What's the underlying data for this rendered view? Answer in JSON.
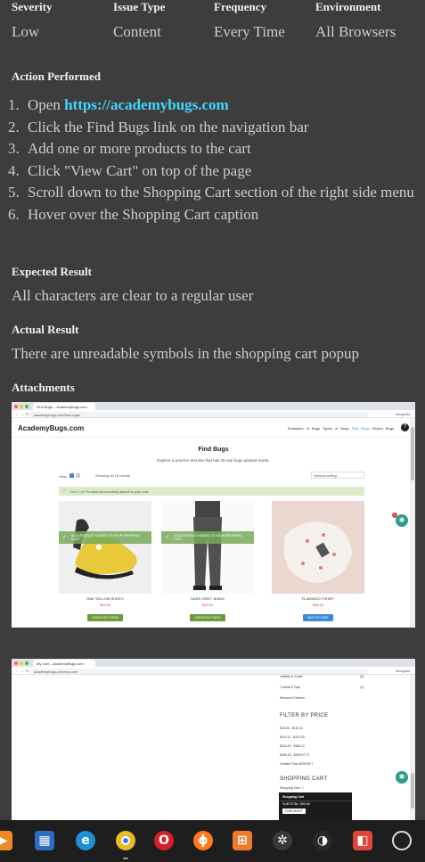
{
  "meta": {
    "headers": [
      "Severity",
      "Issue Type",
      "Frequency",
      "Environment"
    ],
    "values": [
      "Low",
      "Content",
      "Every Time",
      "All Browsers"
    ]
  },
  "action": {
    "title": "Action Performed",
    "steps": [
      {
        "num": "1.",
        "text": "Open ",
        "link": "https://academybugs.com"
      },
      {
        "num": "2.",
        "text": "Click the Find Bugs link on the navigation bar"
      },
      {
        "num": "3.",
        "text": "Add one or more products to the cart"
      },
      {
        "num": "4.",
        "text": "Click \"View Cart\" on top of the page"
      },
      {
        "num": "5.",
        "text": "Scroll down to the Shopping Cart section of the right side menu"
      },
      {
        "num": "6.",
        "text": "Hover over the Shopping Cart caption"
      }
    ]
  },
  "expected": {
    "title": "Expected Result",
    "text": "All characters are clear to a regular user"
  },
  "actual": {
    "title": "Actual Result",
    "text": "There are unreadable symbols in the shopping cart popup"
  },
  "attachments": {
    "title": "Attachments"
  },
  "shot1": {
    "tab": "Find Bugs – AcademyBugs.com",
    "url": "academybugs.com/find-bugs/",
    "profile": "Incognito",
    "logo": "AcademyBugs.com",
    "menu": [
      "Examples of Bugs",
      "Types of Bugs",
      "Find Bugs",
      "Report Bugs"
    ],
    "title": "Find Bugs",
    "subtitle": "Explore a practice test site that has 25 real bugs planted inside.",
    "view_label": "View",
    "showing": "Showing all 18 results",
    "sort": "Default sorting",
    "notice_link": "View Cart",
    "notice_text": "Product successfully added to your cart.",
    "products": [
      {
        "name": "DNK YELLOW SHOES",
        "price": "$45.00",
        "button": "CHECKOUT NOW",
        "overlay": "SUCCESSFULLY ADDED TO YOUR SHOPPING CART"
      },
      {
        "name": "DARK GREY JEANS",
        "price": "$45.00",
        "button": "CHECKOUT NOW",
        "overlay": "SUCCESSFULLY ADDED TO YOUR SHOPPING CART"
      },
      {
        "name": "FLAMINGO TSHIRT",
        "price": "$35.00",
        "button": "ADD TO CART"
      }
    ],
    "cart_count": "2"
  },
  "shot2": {
    "tab": "My Cart – AcademyBugs.com",
    "url": "academybugs.com/my-cart/",
    "profile": "Incognito",
    "sidebar_items": [
      {
        "label": "Jackets & Coats",
        "count": "(3)"
      },
      {
        "label": "T-shirts & Tops",
        "count": "(1)"
      },
      {
        "label": "Women's Fashion",
        "count": ""
      }
    ],
    "filter_title": "FILTER BY PRICE",
    "price_ranges": [
      "$15.00 - $119.11",
      "$119.11 - $119.20",
      "$119.20 - $189.11",
      "$189.20 - $299.97.71",
      "Greater Than $299.99.7"
    ],
    "cart_title": "SHOPPING CART",
    "cart_caption": "Shopping Cart ☐",
    "popup_title": "Shopping Cart",
    "popup_subtotal": "SUBTOTAL: $90.00",
    "popup_button": "CHECKOUT"
  },
  "taskbar": {
    "icons": [
      "media-player-icon",
      "store-icon",
      "edge-icon",
      "chrome-icon",
      "opera-icon",
      "firefox-icon",
      "photo-grid-icon",
      "network-icon",
      "audio-icon",
      "office-icon",
      "circle-icon"
    ]
  }
}
